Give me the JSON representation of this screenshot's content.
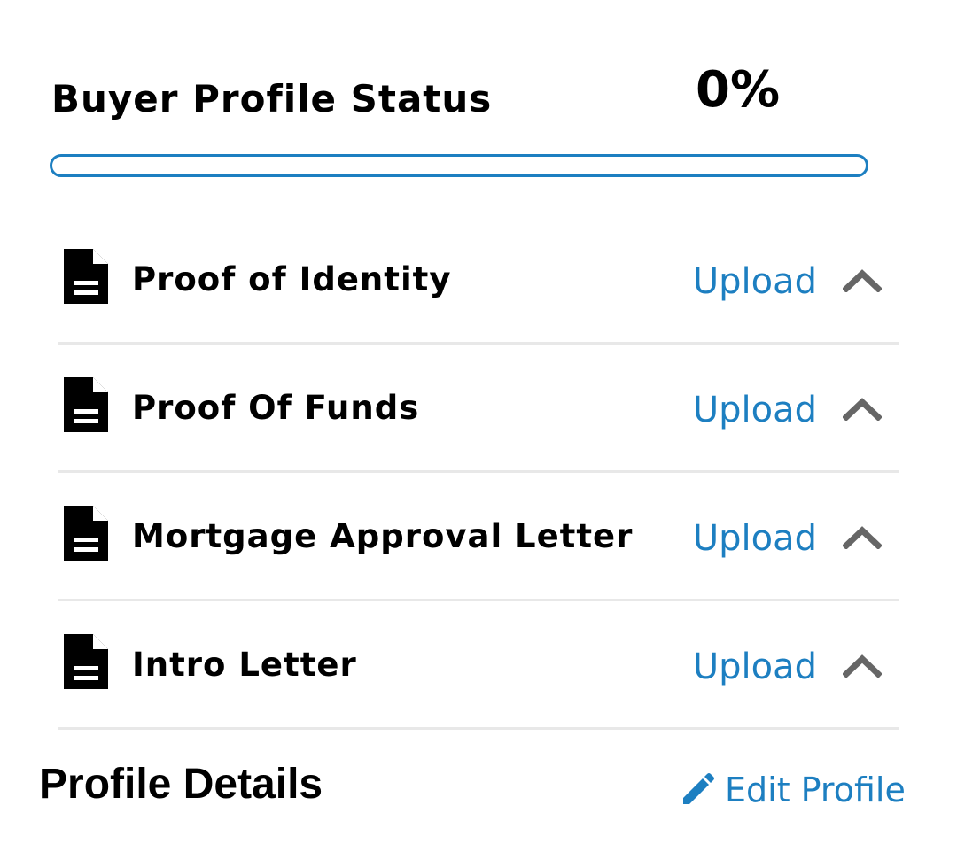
{
  "status": {
    "title": "Buyer Profile Status",
    "percent_label": "0%",
    "progress": 0,
    "accent_color": "#1d7fc1"
  },
  "documents": [
    {
      "label": "Proof of Identity",
      "action": "Upload",
      "icon": "document-icon",
      "toggle_icon": "chevron-up-icon"
    },
    {
      "label": "Proof Of Funds",
      "action": "Upload",
      "icon": "document-icon",
      "toggle_icon": "chevron-up-icon"
    },
    {
      "label": "Mortgage Approval Letter",
      "action": "Upload",
      "icon": "document-icon",
      "toggle_icon": "chevron-up-icon"
    },
    {
      "label": "Intro Letter",
      "action": "Upload",
      "icon": "document-icon",
      "toggle_icon": "chevron-up-icon"
    }
  ],
  "profile_details": {
    "title": "Profile Details",
    "edit_label": "Edit Profile",
    "edit_icon": "pencil-icon"
  }
}
